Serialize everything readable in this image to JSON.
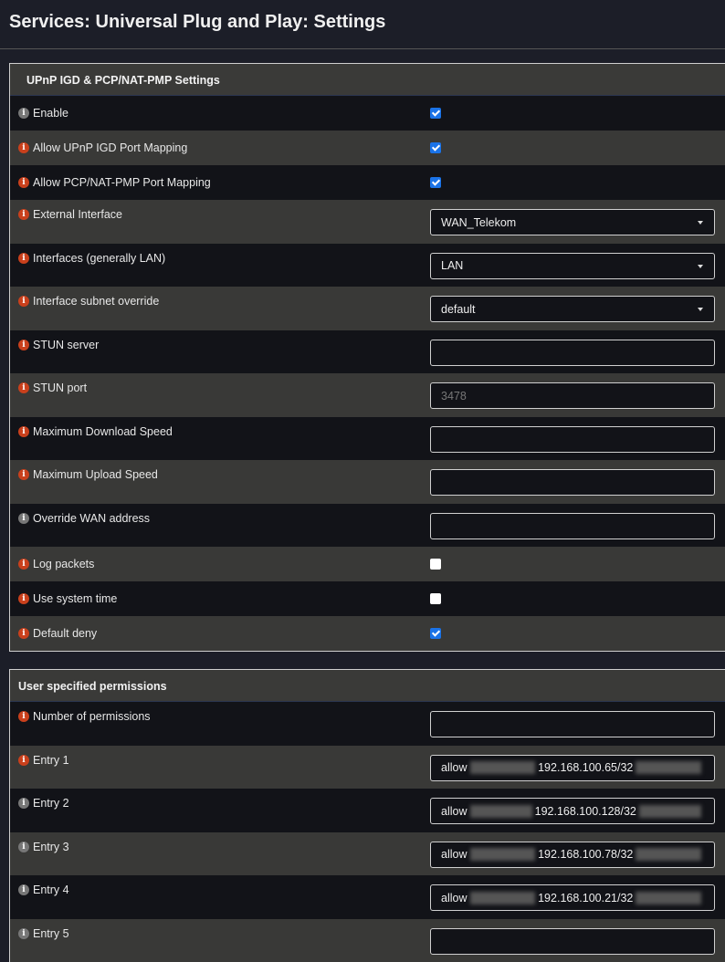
{
  "title": "Services: Universal Plug and Play: Settings",
  "section1": {
    "heading": "UPnP IGD & PCP/NAT-PMP Settings",
    "enable": "Enable",
    "allow_igd": "Allow UPnP IGD Port Mapping",
    "allow_pcp": "Allow PCP/NAT-PMP Port Mapping",
    "ext_if": "External Interface",
    "ext_if_val": "WAN_Telekom",
    "ifs": "Interfaces (generally LAN)",
    "ifs_val": "LAN",
    "subnet": "Interface subnet override",
    "subnet_val": "default",
    "stun_server": "STUN server",
    "stun_port": "STUN port",
    "stun_port_ph": "3478",
    "max_down": "Maximum Download Speed",
    "max_up": "Maximum Upload Speed",
    "override_wan": "Override WAN address",
    "log": "Log packets",
    "systime": "Use system time",
    "deny": "Default deny"
  },
  "section2": {
    "heading": "User specified permissions",
    "num": "Number of permissions",
    "entries": [
      {
        "label": "Entry 1",
        "allow": "allow",
        "ip": "192.168.100.65/32"
      },
      {
        "label": "Entry 2",
        "allow": "allow",
        "ip": "192.168.100.128/32"
      },
      {
        "label": "Entry 3",
        "allow": "allow",
        "ip": "192.168.100.78/32"
      },
      {
        "label": "Entry 4",
        "allow": "allow",
        "ip": "192.168.100.21/32"
      },
      {
        "label": "Entry 5"
      }
    ]
  }
}
